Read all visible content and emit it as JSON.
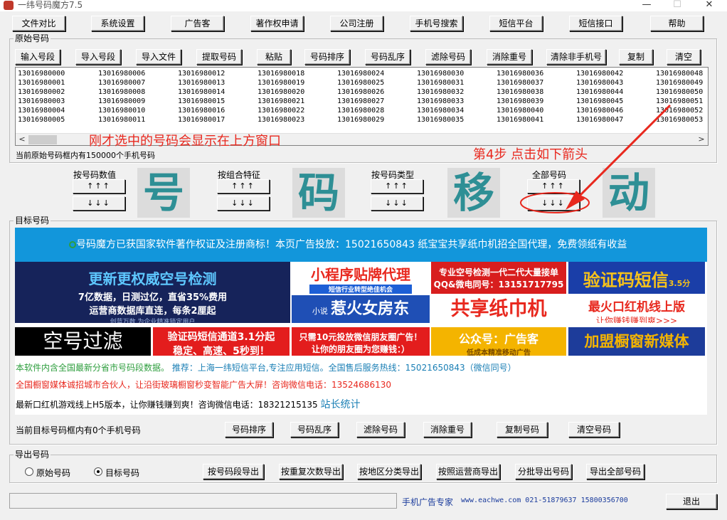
{
  "window": {
    "title": "一纬号码魔方7.5",
    "min": "—",
    "max": "☐",
    "close": "✕"
  },
  "toolbar": [
    "文件对比",
    "系统设置",
    "广告客",
    "著作权申请",
    "公司注册",
    "手机号搜索",
    "短信平台",
    "短信接口",
    "帮助"
  ],
  "source": {
    "group_label": "原始号码",
    "buttons": [
      "输入号段",
      "导入号段",
      "导入文件",
      "提取号码",
      "粘贴",
      "号码排序",
      "号码乱序",
      "滤除号码",
      "消除重号",
      "清除非手机号",
      "复制",
      "清空"
    ],
    "columns": [
      [
        "13016980000",
        "13016980001",
        "13016980002",
        "13016980003",
        "13016980004",
        "13016980005"
      ],
      [
        "13016980006",
        "13016980007",
        "13016980008",
        "13016980009",
        "13016980010",
        "13016980011"
      ],
      [
        "13016980012",
        "13016980013",
        "13016980014",
        "13016980015",
        "13016980016",
        "13016980017"
      ],
      [
        "13016980018",
        "13016980019",
        "13016980020",
        "13016980021",
        "13016980022",
        "13016980023"
      ],
      [
        "13016980024",
        "13016980025",
        "13016980026",
        "13016980027",
        "13016980028",
        "13016980029"
      ],
      [
        "13016980030",
        "13016980031",
        "13016980032",
        "13016980033",
        "13016980034",
        "13016980035"
      ],
      [
        "13016980036",
        "13016980037",
        "13016980038",
        "13016980039",
        "13016980040",
        "13016980041"
      ],
      [
        "13016980042",
        "13016980043",
        "13016980044",
        "13016980045",
        "13016980046",
        "13016980047"
      ],
      [
        "13016980048",
        "13016980049",
        "13016980050",
        "13016980051",
        "13016980052",
        "13016980053"
      ]
    ],
    "status": "当前原始号码框内有150000个手机号码"
  },
  "annotations": {
    "hint_window": "刚才选中的号码会显示在上方窗口",
    "hint_step": "第4步   点击如下箭头"
  },
  "move": {
    "groups": [
      {
        "label": "按号码数值",
        "up": "↑↑↑",
        "down": "↓↓↓"
      },
      {
        "label": "按组合特征",
        "up": "↑↑↑",
        "down": "↓↓↓"
      },
      {
        "label": "按号码类型",
        "up": "↑↑↑",
        "down": "↓↓↓"
      },
      {
        "label": "全部号码",
        "up": "↑↑↑",
        "down": "↓↓↓"
      }
    ],
    "chars": [
      "号",
      "码",
      "移",
      "动"
    ]
  },
  "target": {
    "group_label": "目标号码",
    "banner": "号码魔方已获国家软件著作权证及注册商标！本页广告投放：15021650843 纸宝宝共享纸巾机招全国代理，免费领纸有收益",
    "ads": {
      "a1_title": "更新更权威空号检测",
      "a1_line1": "7亿数据，日测过亿，直省35%费用",
      "a1_line2": "运营商数据库直连，每条2厘起",
      "a1_foot": "创蓝万数    为企业精准锁定用户",
      "a2_title": "小程序贴牌代理",
      "a2_sub": "短信行业转型绝佳机会",
      "a3_line1": "专业空号检测一代二代大量接单",
      "a3_line2": "QQ&微电同号：13151717795",
      "a4_title": "验证码短信",
      "a4_price": "3.5分",
      "a5_main": "惹火女房东",
      "a5_small": "小说",
      "a6": "共享纸巾机",
      "a7_line1": "最火口红机线上版",
      "a7_line2": "让你赚钱赚到爽>>>",
      "a8": "空号过滤",
      "a9_line1": "验证码短信通道3.1分起",
      "a9_line2": "稳定、高速、5秒到！",
      "a10_line1": "只需10元投放微信朋友圈广告！",
      "a10_line2": "让你的朋友圈为您赚钱：）",
      "a11_title": "公众号：广告客",
      "a11_sub": "低成本精准移动广告",
      "a12": "加盟橱窗新媒体"
    },
    "line1_a": "本软件内含全国最新分省市号码段数据。",
    "line1_b": "推荐：上海一纬短信平台,专注应用短信。全国售后服务热线：15021650843（微信同号）",
    "line2": "全国橱窗媒体诚招城市合伙人，让沿街玻璃橱窗秒变智能广告大屏！咨询微信电话：13524686130",
    "line3_a": "最新口红机游戏线上H5版本，让你赚钱赚到爽！咨询微信电话：18321215135",
    "line3_b": "站长统计",
    "status": "当前目标号码框内有0个手机号码",
    "buttons": [
      "号码排序",
      "号码乱序",
      "滤除号码",
      "消除重号",
      "复制号码",
      "清空号码"
    ]
  },
  "export": {
    "group_label": "导出号码",
    "radio_source": "原始号码",
    "radio_target": "目标号码",
    "buttons": [
      "按号码段导出",
      "按重复次数导出",
      "按地区分类导出",
      "按照运营商导出",
      "分批导出号码",
      "导出全部号码"
    ]
  },
  "footer": {
    "brand": "手机广告专家",
    "contact": "www.eachwe.com  021-51879637   15800356700",
    "exit": "退出"
  },
  "colors": {
    "accent": "#1296db",
    "annotation": "#e8281e",
    "bigchar": "#2e8f95"
  }
}
